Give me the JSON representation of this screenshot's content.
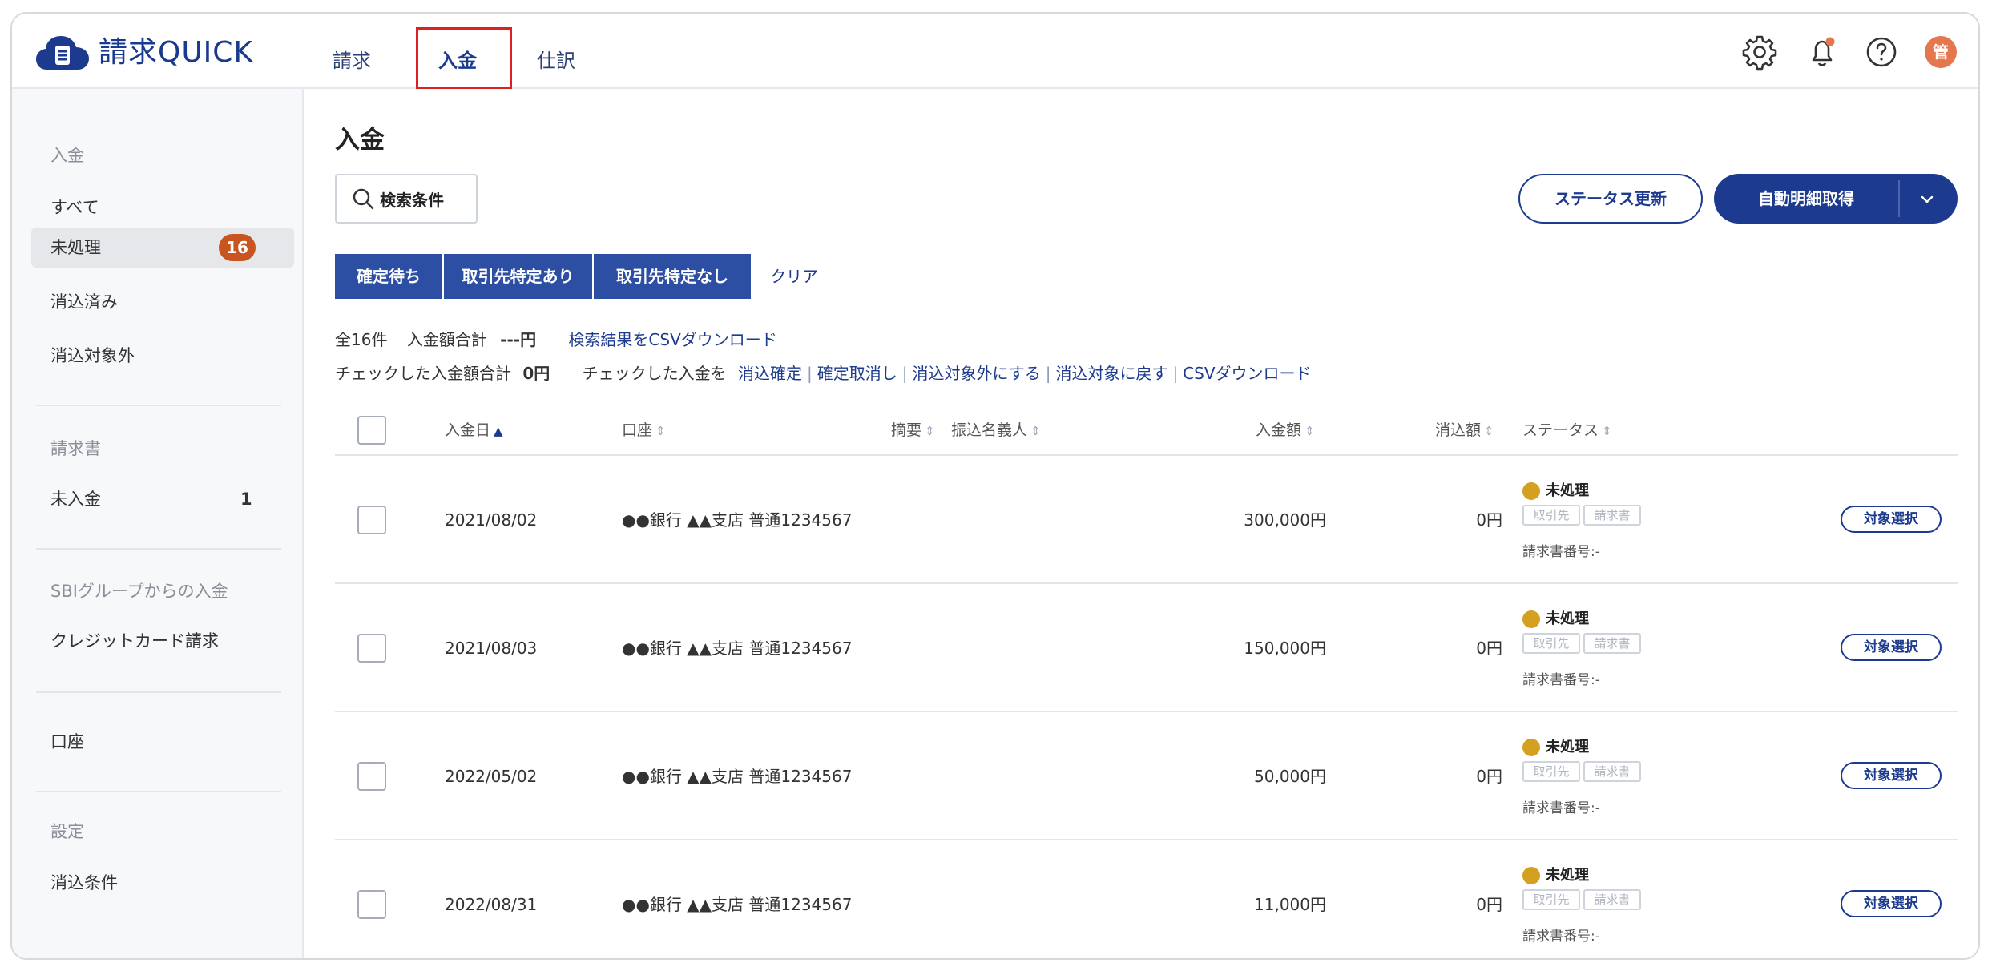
{
  "app": {
    "name": "請求QUICK",
    "colors": {
      "brand": "#1d3b8e",
      "badge": "#c8541f",
      "pending_dot": "#d4a020",
      "highlight": "#e02020"
    }
  },
  "header": {
    "tabs": [
      {
        "label": "請求"
      },
      {
        "label": "入金",
        "active": true
      },
      {
        "label": "仕訳"
      }
    ],
    "icons": [
      "gear-icon",
      "bell-icon",
      "help-icon"
    ],
    "avatar": "管"
  },
  "sidebar": {
    "section_payment": "入金",
    "all": "すべて",
    "unprocessed": "未処理",
    "unprocessed_count": "16",
    "cleared": "消込済み",
    "excluded": "消込対象外",
    "section_invoice": "請求書",
    "unpaid": "未入金",
    "unpaid_count": "1",
    "section_sbi": "SBIグループからの入金",
    "credit_card": "クレジットカード請求",
    "account": "口座",
    "section_settings": "設定",
    "clearing_conditions": "消込条件"
  },
  "main": {
    "title": "入金",
    "search_label": "検索条件",
    "status_update": "ステータス更新",
    "auto_fetch": "自動明細取得",
    "filters": [
      "確定待ち",
      "取引先特定あり",
      "取引先特定なし"
    ],
    "clear": "クリア",
    "summary": {
      "total_count": "全16件",
      "amount_label": "入金額合計",
      "amount_value": "---円",
      "csv_results": "検索結果をCSVダウンロード",
      "checked_amount_label": "チェックした入金額合計",
      "checked_amount_value": "0円",
      "checked_action_prefix": "チェックした入金を",
      "actions": [
        "消込確定",
        "確定取消し",
        "消込対象外にする",
        "消込対象に戻す",
        "CSVダウンロード"
      ]
    },
    "table": {
      "columns": {
        "date": "入金日",
        "account": "口座",
        "summary": "摘要",
        "payer": "振込名義人",
        "amount": "入金額",
        "cleared": "消込額",
        "status": "ステータス"
      },
      "rows": [
        {
          "date": "2021/08/02",
          "account": "●●銀行 ▲▲支店 普通1234567",
          "amount": "300,000円",
          "cleared": "0円",
          "status": "未処理",
          "chip_client": "取引先",
          "chip_invoice": "請求書",
          "invoice_no": "請求書番号:-",
          "action": "対象選択"
        },
        {
          "date": "2021/08/03",
          "account": "●●銀行 ▲▲支店 普通1234567",
          "amount": "150,000円",
          "cleared": "0円",
          "status": "未処理",
          "chip_client": "取引先",
          "chip_invoice": "請求書",
          "invoice_no": "請求書番号:-",
          "action": "対象選択"
        },
        {
          "date": "2022/05/02",
          "account": "●●銀行 ▲▲支店 普通1234567",
          "amount": "50,000円",
          "cleared": "0円",
          "status": "未処理",
          "chip_client": "取引先",
          "chip_invoice": "請求書",
          "invoice_no": "請求書番号:-",
          "action": "対象選択"
        },
        {
          "date": "2022/08/31",
          "account": "●●銀行 ▲▲支店 普通1234567",
          "amount": "11,000円",
          "cleared": "0円",
          "status": "未処理",
          "chip_client": "取引先",
          "chip_invoice": "請求書",
          "invoice_no": "請求書番号:-",
          "action": "対象選択"
        }
      ]
    }
  }
}
